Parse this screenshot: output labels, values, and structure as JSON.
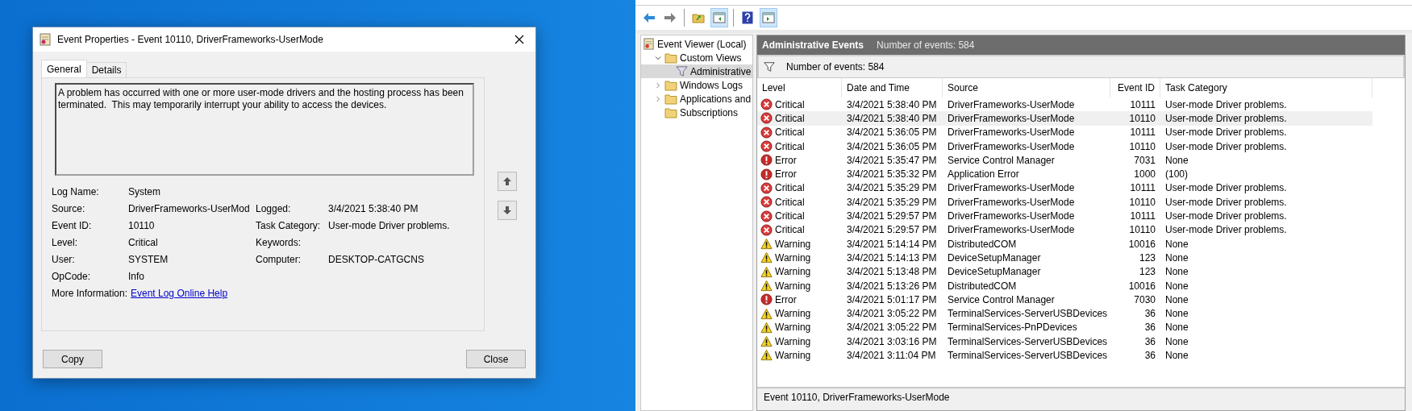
{
  "dialog": {
    "title": "Event Properties - Event 10110, DriverFrameworks-UserMode",
    "tabs": [
      {
        "label": "General",
        "selected": true
      },
      {
        "label": "Details",
        "selected": false
      }
    ],
    "description": "A problem has occurred with one or more user-mode drivers and the hosting process has been terminated.  This may temporarily interrupt your ability to access the devices.",
    "fields": [
      {
        "left": {
          "label": "Log Name:",
          "value": "System"
        }
      },
      {
        "left": {
          "label": "Source:",
          "value": "DriverFrameworks-UserMod"
        },
        "right": {
          "label": "Logged:",
          "value": "3/4/2021 5:38:40 PM"
        }
      },
      {
        "left": {
          "label": "Event ID:",
          "value": "10110"
        },
        "right": {
          "label": "Task Category:",
          "value": "User-mode Driver problems."
        }
      },
      {
        "left": {
          "label": "Level:",
          "value": "Critical"
        },
        "right": {
          "label": "Keywords:"
        }
      },
      {
        "left": {
          "label": "User:",
          "value": "SYSTEM"
        },
        "right": {
          "label": "Computer:",
          "value": "DESKTOP-CATGCNS"
        }
      },
      {
        "left": {
          "label": "OpCode:",
          "value": "Info"
        }
      },
      {
        "left": {
          "label": "More Information:",
          "link": "Event Log Online Help"
        }
      }
    ],
    "buttons": [
      "Copy",
      "Close"
    ]
  },
  "viewer": {
    "toolbar": [
      [
        {
          "kind": "back",
          "pressed": false
        },
        {
          "kind": "forward",
          "pressed": false
        }
      ],
      [
        {
          "kind": "folder-up",
          "pressed": false
        },
        {
          "kind": "tree-pane",
          "pressed": true
        }
      ],
      [
        {
          "kind": "help",
          "pressed": false
        },
        {
          "kind": "action-pane",
          "pressed": true
        }
      ]
    ],
    "tree": [
      {
        "label": "Event Viewer (Local)",
        "kind": "root",
        "selected": false,
        "children": [
          {
            "label": "Custom Views",
            "kind": "folder",
            "expanded": true,
            "selected": false,
            "children": [
              {
                "label": "Administrative",
                "kind": "filter",
                "selected": true
              }
            ]
          },
          {
            "label": "Windows Logs",
            "kind": "folder",
            "expanded": false,
            "selected": false
          },
          {
            "label": "Applications and",
            "kind": "folder",
            "expanded": false,
            "selected": false
          },
          {
            "label": "Subscriptions",
            "kind": "folder",
            "selected": false
          }
        ]
      }
    ],
    "header": {
      "title": "Administrative Events",
      "count": "Number of events: 584"
    },
    "filter_bar": "Number of events: 584",
    "table": {
      "columns": [
        "Level",
        "Date and Time",
        "Source",
        "Event ID",
        "Task Category"
      ],
      "rows": [
        {
          "kind": "critical",
          "level_text": "Critical",
          "date": "3/4/2021 5:38:40 PM",
          "source": "DriverFrameworks-UserMode",
          "event_id": "10111",
          "category": "User-mode Driver problems.",
          "selected": false
        },
        {
          "kind": "critical",
          "level_text": "Critical",
          "date": "3/4/2021 5:38:40 PM",
          "source": "DriverFrameworks-UserMode",
          "event_id": "10110",
          "category": "User-mode Driver problems.",
          "selected": true
        },
        {
          "kind": "critical",
          "level_text": "Critical",
          "date": "3/4/2021 5:36:05 PM",
          "source": "DriverFrameworks-UserMode",
          "event_id": "10111",
          "category": "User-mode Driver problems.",
          "selected": false
        },
        {
          "kind": "critical",
          "level_text": "Critical",
          "date": "3/4/2021 5:36:05 PM",
          "source": "DriverFrameworks-UserMode",
          "event_id": "10110",
          "category": "User-mode Driver problems.",
          "selected": false
        },
        {
          "kind": "error",
          "level_text": "Error",
          "date": "3/4/2021 5:35:47 PM",
          "source": "Service Control Manager",
          "event_id": "7031",
          "category": "None",
          "selected": false
        },
        {
          "kind": "error",
          "level_text": "Error",
          "date": "3/4/2021 5:35:32 PM",
          "source": "Application Error",
          "event_id": "1000",
          "category": "(100)",
          "selected": false
        },
        {
          "kind": "critical",
          "level_text": "Critical",
          "date": "3/4/2021 5:35:29 PM",
          "source": "DriverFrameworks-UserMode",
          "event_id": "10111",
          "category": "User-mode Driver problems.",
          "selected": false
        },
        {
          "kind": "critical",
          "level_text": "Critical",
          "date": "3/4/2021 5:35:29 PM",
          "source": "DriverFrameworks-UserMode",
          "event_id": "10110",
          "category": "User-mode Driver problems.",
          "selected": false
        },
        {
          "kind": "critical",
          "level_text": "Critical",
          "date": "3/4/2021 5:29:57 PM",
          "source": "DriverFrameworks-UserMode",
          "event_id": "10111",
          "category": "User-mode Driver problems.",
          "selected": false
        },
        {
          "kind": "critical",
          "level_text": "Critical",
          "date": "3/4/2021 5:29:57 PM",
          "source": "DriverFrameworks-UserMode",
          "event_id": "10110",
          "category": "User-mode Driver problems.",
          "selected": false
        },
        {
          "kind": "warning",
          "level_text": "Warning",
          "date": "3/4/2021 5:14:14 PM",
          "source": "DistributedCOM",
          "event_id": "10016",
          "category": "None",
          "selected": false
        },
        {
          "kind": "warning",
          "level_text": "Warning",
          "date": "3/4/2021 5:14:13 PM",
          "source": "DeviceSetupManager",
          "event_id": "123",
          "category": "None",
          "selected": false
        },
        {
          "kind": "warning",
          "level_text": "Warning",
          "date": "3/4/2021 5:13:48 PM",
          "source": "DeviceSetupManager",
          "event_id": "123",
          "category": "None",
          "selected": false
        },
        {
          "kind": "warning",
          "level_text": "Warning",
          "date": "3/4/2021 5:13:26 PM",
          "source": "DistributedCOM",
          "event_id": "10016",
          "category": "None",
          "selected": false
        },
        {
          "kind": "error",
          "level_text": "Error",
          "date": "3/4/2021 5:01:17 PM",
          "source": "Service Control Manager",
          "event_id": "7030",
          "category": "None",
          "selected": false
        },
        {
          "kind": "warning",
          "level_text": "Warning",
          "date": "3/4/2021 3:05:22 PM",
          "source": "TerminalServices-ServerUSBDevices",
          "event_id": "36",
          "category": "None",
          "selected": false
        },
        {
          "kind": "warning",
          "level_text": "Warning",
          "date": "3/4/2021 3:05:22 PM",
          "source": "TerminalServices-PnPDevices",
          "event_id": "36",
          "category": "None",
          "selected": false
        },
        {
          "kind": "warning",
          "level_text": "Warning",
          "date": "3/4/2021 3:03:16 PM",
          "source": "TerminalServices-ServerUSBDevices",
          "event_id": "36",
          "category": "None",
          "selected": false
        },
        {
          "kind": "warning",
          "level_text": "Warning",
          "date": "3/4/2021 3:11:04 PM",
          "source": "TerminalServices-ServerUSBDevices",
          "event_id": "36",
          "category": "None",
          "selected": false
        }
      ]
    },
    "status_bar": "Event 10110, DriverFrameworks-UserMode"
  }
}
